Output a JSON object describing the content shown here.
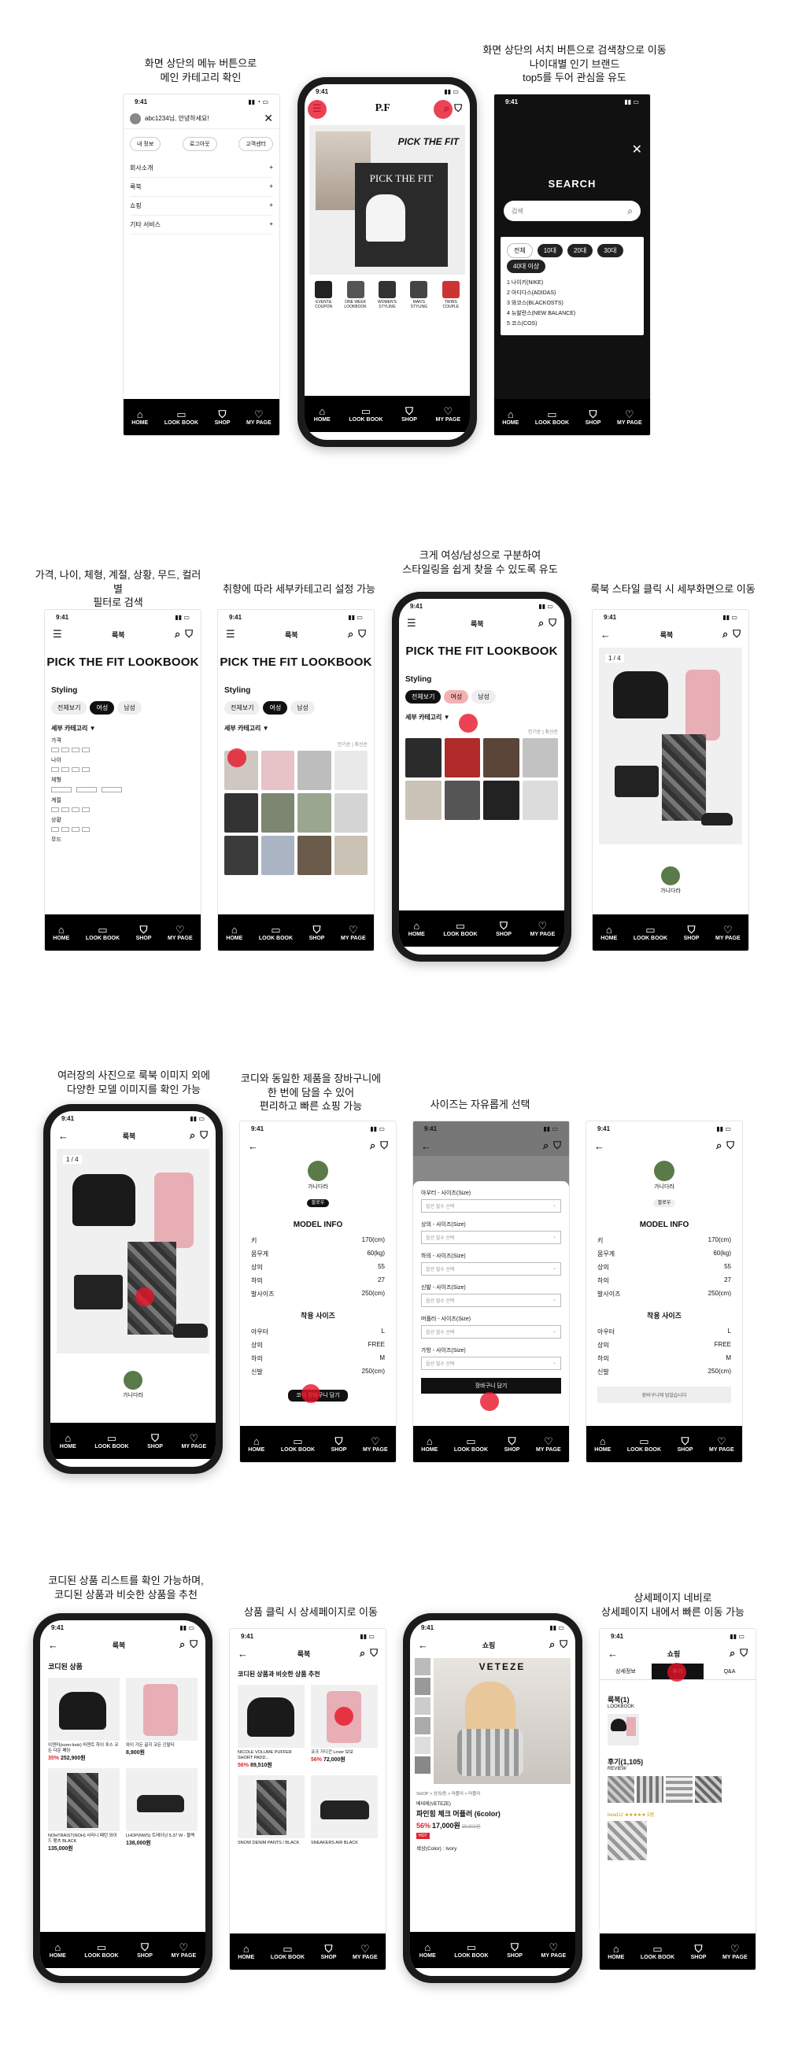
{
  "captions": {
    "c1": "화면 상단의 메뉴 버튼으로\n메인 카테고리 확인",
    "c2": "화면 상단의 서치 버튼으로 검색창으로 이동\n나이대별 인기 브랜드\ntop5를 두어 관심을 유도",
    "c3": "가격, 나이, 체형, 계절, 상황, 무드, 컬러별\n필터로 검색",
    "c4": "취향에 따라 세부카테고리 설정 가능",
    "c5": "크게 여성/남성으로 구분하여\n스타일링을 쉽게 찾을 수 있도록 유도",
    "c6": "룩북 스타일 클릭 시 세부화면으로 이동",
    "c7": "여러장의 사진으로 룩북 이미지 외에\n다양한 모델 이미지를 확인 가능",
    "c8": "코디와 동일한 제품을 장바구니에\n한 번에 담을 수 있어\n편리하고 빠른 쇼핑 가능",
    "c9": "사이즈는 자유롭게 선택",
    "c10": "코디된 상품 리스트를 확인 가능하며,\n코디된 상품과 비슷한 상품을 추천",
    "c11": "상품 클릭 시 상세페이지로 이동",
    "c12": "상세페이지 네비로\n상세페이지 내에서 빠른 이동 가능"
  },
  "status_time": "9:41",
  "nav": [
    "HOME",
    "LOOK BOOK",
    "SHOP",
    "MY PAGE"
  ],
  "menu": {
    "greeting": "abc1234님, 안녕하세요!",
    "quick": [
      "내 정보",
      "로그아웃",
      "고객센터"
    ],
    "items": [
      "회사소개",
      "룩북",
      "쇼핑",
      "기타 서비스"
    ]
  },
  "home": {
    "logo": "P.F",
    "banner": "PICK THE FIT",
    "banner_script": "PICK THE FIT",
    "cats": [
      "EVENT& COUPON",
      "ONE WEEK LOOKBOOK",
      "WOMEN'S STYLING",
      "MAN'S STYLING",
      "TWINS COUPLE"
    ]
  },
  "search": {
    "title": "SEARCH",
    "placeholder": "검색",
    "ages": [
      "전체",
      "10대",
      "20대",
      "30대",
      "40대 이상"
    ],
    "brands": [
      "1  나이키(NIKE)",
      "2  아디다스(ADIDAS)",
      "3  와코스(BLACKOSTS)",
      "4  뉴발란스(NEW BALANCE)",
      "5  코스(COS)"
    ]
  },
  "lookbook": {
    "header": "룩북",
    "title": "PICK THE FIT LOOKBOOK",
    "styling": "Styling",
    "tabs": [
      "전체보기",
      "여성",
      "남성"
    ],
    "subcat": "세부 카테고리 ▼",
    "filters": [
      "가격",
      "나이",
      "체형",
      "계절",
      "상황",
      "무드"
    ],
    "sort": "인기순 | 최신순"
  },
  "detail": {
    "counter": "1 / 4",
    "model_name": "가니다라",
    "follow": "팔로우"
  },
  "model_info": {
    "title": "MODEL INFO",
    "rows": [
      [
        "키",
        "170(cm)"
      ],
      [
        "몸무게",
        "60(kg)"
      ],
      [
        "상의",
        "55"
      ],
      [
        "하의",
        "27"
      ],
      [
        "발사이즈",
        "250(cm)"
      ]
    ],
    "worn_title": "착용 사이즈",
    "worn": [
      [
        "아우터",
        "L"
      ],
      [
        "상의",
        "FREE"
      ],
      [
        "하의",
        "M"
      ],
      [
        "신발",
        "250(cm)"
      ]
    ],
    "cart_btn": "코디 장바구니 담기",
    "cart_done": "장바구니에 담았습니다"
  },
  "size_sheet": {
    "labels": [
      "아우터 - 사이즈(Size)",
      "상의 - 사이즈(Size)",
      "하의 - 사이즈(Size)",
      "신발 - 사이즈(Size)",
      "머플러 - 사이즈(Size)",
      "가방 - 사이즈(Size)"
    ],
    "select": "옵션 필수 선택",
    "btn": "장바구니 담기"
  },
  "coordi": {
    "title": "코디된 상품",
    "items": [
      {
        "name": "이젠미(ezen-look) 마젠트 하이 포스 코든 다운 패딩",
        "pct": "35%",
        "price": "252,900원"
      },
      {
        "name": "와이 가든 골지 코든 긴팔티",
        "pct": "",
        "price": "8,900원"
      },
      {
        "name": "NOHTRAIST(NOH) 사라니 패턴 와이드 팬츠 BLACK",
        "pct": "",
        "price": "135,000원"
      },
      {
        "name": "LHOP(NWS) 트레이닝 5.37 W - 블랙",
        "pct": "",
        "price": "138,000원"
      }
    ]
  },
  "similar": {
    "title": "코디된 상품과 비슷한 상품 추천",
    "items": [
      {
        "name": "NICOLE VOLUME PUFFER SHORT PADD...",
        "pct": "56%",
        "price": "89,510원"
      },
      {
        "name": "코크 가디건 Lover 보보",
        "pct": "56%",
        "price": "72,000원"
      },
      {
        "name": "SNOW DENIM PANTS / BLACK",
        "pct": "",
        "price": ""
      },
      {
        "name": "SNEAKERS AIR BLACK",
        "pct": "",
        "price": ""
      }
    ]
  },
  "product": {
    "header": "쇼핑",
    "brand_banner": "VETEZE",
    "breadcrumb": "SHOP > 상의/등 > 머플러 > 머플러",
    "brand": "베테제(VETEZE)",
    "name": "파인힘 체크 머플러 (6color)",
    "pct": "56%",
    "price": "17,000원",
    "old_price": "39,900원",
    "tag": "HOT",
    "option": "색상(Color) : Ivory"
  },
  "pdp_nav": {
    "tabs": [
      "상세정보",
      "후기",
      "Q&A"
    ],
    "lookbook_label": "룩북(1)",
    "lookbook_sub": "LOOKBOOK",
    "review_label": "후기(1,105)",
    "review_sub": "REVIEW",
    "reviewer": "bead12 ★★★★★ 5점"
  }
}
